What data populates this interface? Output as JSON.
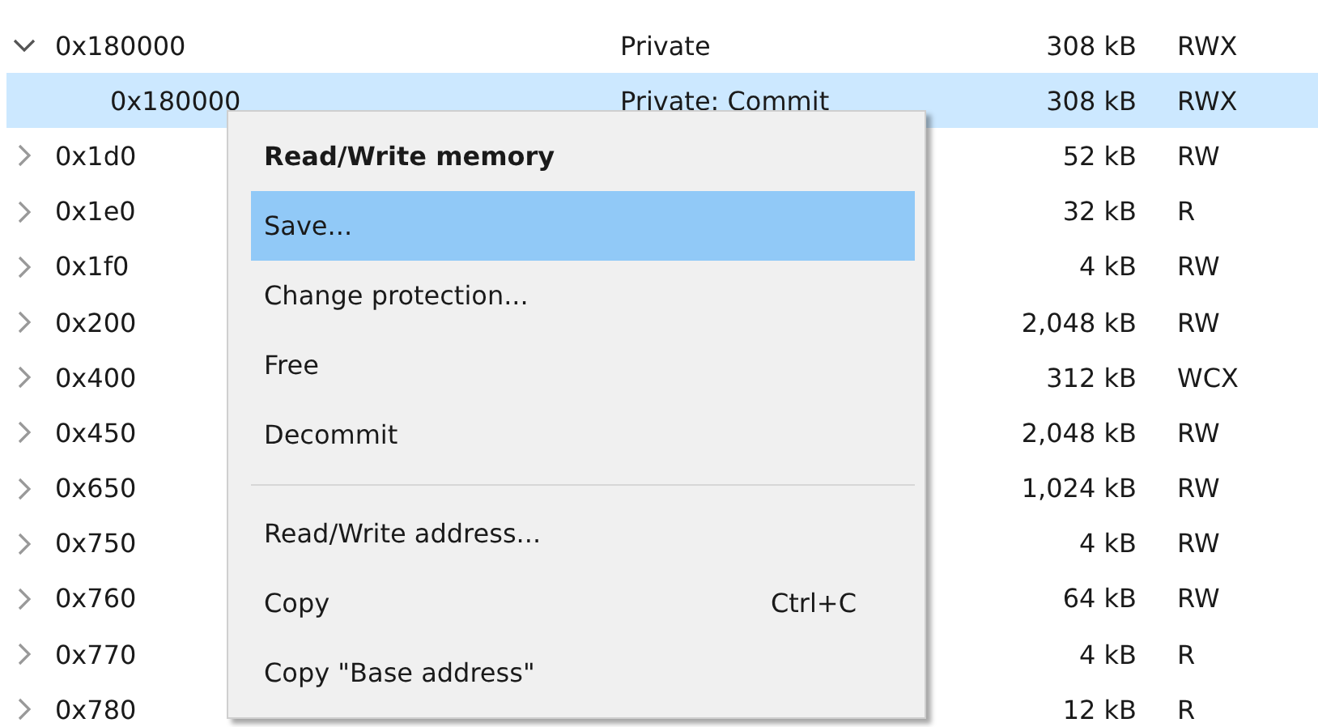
{
  "rows": [
    {
      "address": "0x180000",
      "type": "Private",
      "size": "308 kB",
      "protection": "RWX",
      "expanded": true,
      "selected": false,
      "children": [
        {
          "address": "0x180000",
          "type": "Private: Commit",
          "size": "308 kB",
          "protection": "RWX",
          "selected": true
        }
      ]
    },
    {
      "address": "0x1d0",
      "size": "52 kB",
      "protection": "RW",
      "expanded": false,
      "selected": false
    },
    {
      "address": "0x1e0",
      "size": "32 kB",
      "protection": "R",
      "expanded": false,
      "selected": false
    },
    {
      "address": "0x1f0",
      "size": "4 kB",
      "protection": "RW",
      "expanded": false,
      "selected": false
    },
    {
      "address": "0x200",
      "size": "2,048 kB",
      "protection": "RW",
      "expanded": false,
      "selected": false
    },
    {
      "address": "0x400",
      "size": "312 kB",
      "protection": "WCX",
      "expanded": false,
      "selected": false
    },
    {
      "address": "0x450",
      "size": "2,048 kB",
      "protection": "RW",
      "expanded": false,
      "selected": false
    },
    {
      "address": "0x650",
      "size": "1,024 kB",
      "protection": "RW",
      "expanded": false,
      "selected": false
    },
    {
      "address": "0x750",
      "size": "4 kB",
      "protection": "RW",
      "expanded": false,
      "selected": false
    },
    {
      "address": "0x760",
      "size": "64 kB",
      "protection": "RW",
      "expanded": false,
      "selected": false
    },
    {
      "address": "0x770",
      "size": "4 kB",
      "protection": "R",
      "expanded": false,
      "selected": false
    },
    {
      "address": "0x780",
      "size": "12 kB",
      "protection": "R",
      "expanded": false,
      "selected": false
    }
  ],
  "context_menu": {
    "items": [
      {
        "kind": "default",
        "label": "Read/Write memory",
        "selected": false
      },
      {
        "kind": "item",
        "label": "Save...",
        "selected": true
      },
      {
        "kind": "item",
        "label": "Change protection...",
        "selected": false
      },
      {
        "kind": "item",
        "label": "Free",
        "selected": false
      },
      {
        "kind": "item",
        "label": "Decommit",
        "selected": false
      },
      {
        "kind": "separator"
      },
      {
        "kind": "item",
        "label": "Read/Write address...",
        "selected": false
      },
      {
        "kind": "item",
        "label": "Copy",
        "shortcut": "Ctrl+C",
        "selected": false
      },
      {
        "kind": "item",
        "label": "Copy \"Base address\"",
        "selected": false
      }
    ]
  }
}
